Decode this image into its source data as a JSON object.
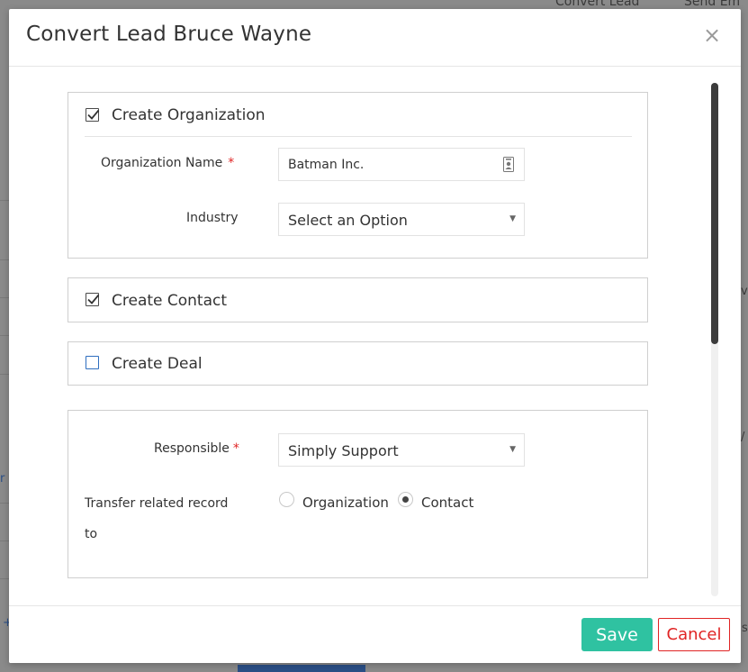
{
  "background": {
    "top_links": [
      "Convert Lead",
      "Send Em"
    ],
    "right_fragments": [
      "vi",
      "/",
      "s"
    ],
    "left_fragments": [
      "r",
      "+"
    ]
  },
  "modal": {
    "title": "Convert Lead Bruce Wayne",
    "close_glyph": "×",
    "sections": {
      "organization": {
        "label": "Create Organization",
        "checked": true,
        "fields": {
          "name_label": "Organization Name",
          "name_required": "*",
          "name_value": "Batman Inc.",
          "industry_label": "Industry",
          "industry_value": "Select an Option"
        }
      },
      "contact": {
        "label": "Create Contact",
        "checked": true
      },
      "deal": {
        "label": "Create Deal",
        "checked": false
      },
      "assignment": {
        "responsible_label": "Responsible",
        "responsible_required": "*",
        "responsible_value": "Simply Support",
        "transfer_label_line1": "Transfer related record",
        "transfer_label_line2": "to",
        "radio_options": [
          {
            "label": "Organization",
            "checked": false
          },
          {
            "label": "Contact",
            "checked": true
          }
        ]
      }
    },
    "footer": {
      "save_label": "Save",
      "cancel_label": "Cancel"
    }
  },
  "colors": {
    "save_bg": "#2fc2a1",
    "cancel_fg": "#e02424",
    "required": "#e02424",
    "checkbox_unchecked": "#2f6fbf"
  }
}
